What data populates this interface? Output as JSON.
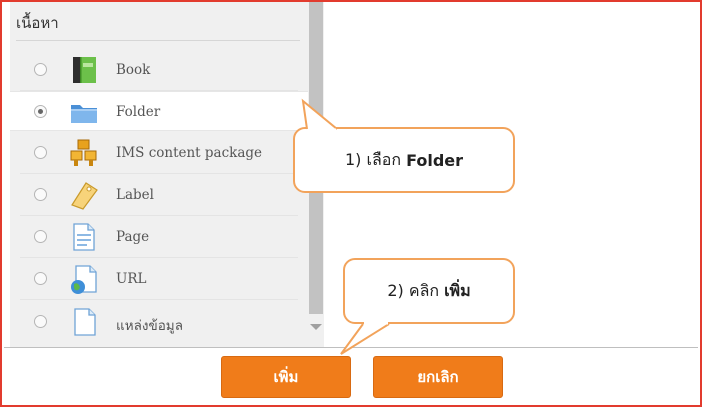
{
  "section": {
    "title": "เนื้อหา"
  },
  "modules": [
    {
      "label": "Book",
      "icon": "book-icon",
      "selected": false
    },
    {
      "label": "Folder",
      "icon": "folder-icon",
      "selected": true
    },
    {
      "label": "IMS content package",
      "icon": "ims-package-icon",
      "selected": false
    },
    {
      "label": "Label",
      "icon": "label-tag-icon",
      "selected": false
    },
    {
      "label": "Page",
      "icon": "page-icon",
      "selected": false
    },
    {
      "label": "URL",
      "icon": "url-globe-icon",
      "selected": false
    },
    {
      "label": "แหล่งข้อมูล",
      "icon": "file-icon",
      "selected": false
    }
  ],
  "buttons": {
    "add": "เพิ่ม",
    "cancel": "ยกเลิก"
  },
  "callouts": {
    "step1": {
      "prefix": "1) เลือก",
      "bold": "Folder"
    },
    "step2": {
      "prefix": "2) คลิก",
      "bold": "เพิ่ม"
    }
  },
  "colors": {
    "accent": "#f07c1a",
    "frame": "#e23b2e",
    "callout_border": "#f2a35b"
  }
}
